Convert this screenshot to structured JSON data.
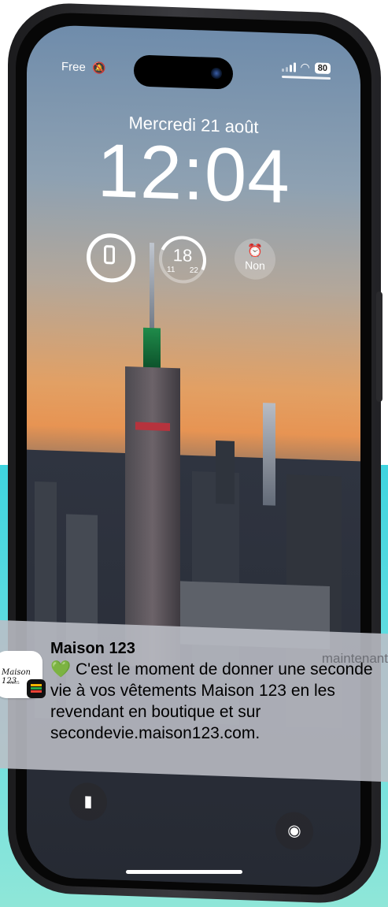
{
  "status_bar": {
    "carrier": "Free",
    "silent_icon": "bell-slash-icon",
    "signal_icon": "signal-bars-icon",
    "wifi_icon": "wifi-icon",
    "battery": "80"
  },
  "lock_screen": {
    "date": "Mercredi 21 août",
    "time": "12:04"
  },
  "widgets": {
    "phone_battery_icon": "iphone-icon",
    "weather": {
      "temp": "18",
      "low": "11",
      "high": "22"
    },
    "alarm": {
      "icon": "alarm-clock-icon",
      "label": "Non"
    }
  },
  "notification": {
    "app_name": "Maison 123",
    "time": "maintenant",
    "emoji": "💚",
    "message": "C'est le moment de donner une seconde vie à vos vêtements Maison 123 en les revendant en boutique et sur secondevie.maison123.com.",
    "app_icon": "maison-123-logo",
    "app_icon_text": "Maison 123",
    "app_icon_sub": "PARIS",
    "badge_icon": "wallet-icon"
  },
  "bottom_controls": {
    "left": "flashlight-icon",
    "right": "camera-icon"
  },
  "colors": {
    "background_accent": "#3fd4df",
    "notification_bg": "#bcbec6",
    "heart": "#4cc44a"
  }
}
